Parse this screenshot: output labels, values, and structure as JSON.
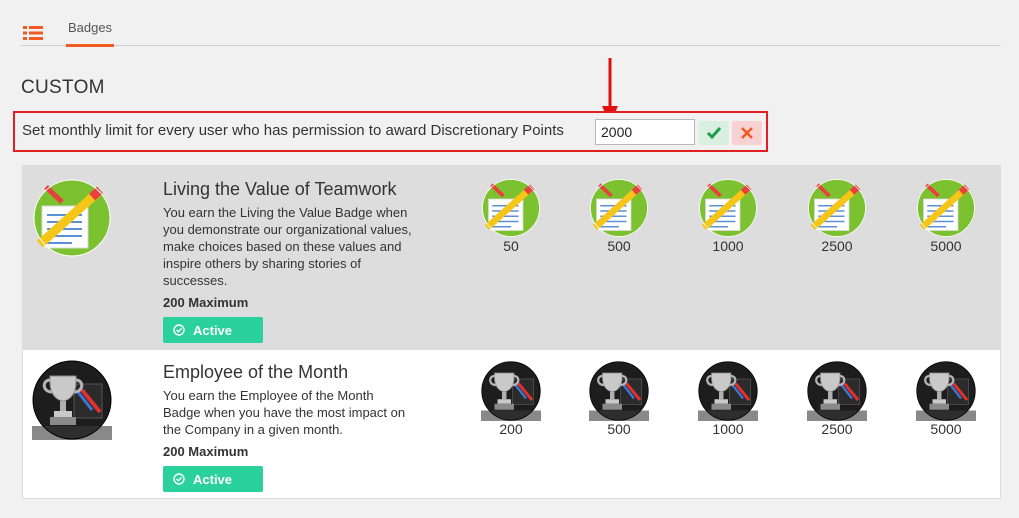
{
  "header": {
    "menu_icon": "list-icon",
    "tab_label": "Badges"
  },
  "section_title": "CUSTOM",
  "limit": {
    "label": "Set monthly limit for every user who has permission to award Discretionary Points",
    "value": "2000",
    "confirm_icon": "check-icon",
    "cancel_icon": "close-icon"
  },
  "colors": {
    "accent": "#f15a22",
    "highlight_border": "#e02020",
    "active_green": "#2ad19a",
    "row_selected": "#dddddd"
  },
  "badges": [
    {
      "name": "Living the Value of Teamwork",
      "description": "You earn the Living the Value Badge when you demonstrate our organizational values, make choices based on these values and inspire others by sharing stories of successes.",
      "maximum": "200 Maximum",
      "status": "Active",
      "icon": "pencil-document-badge-icon",
      "levels": [
        "50",
        "500",
        "1000",
        "2500",
        "5000"
      ]
    },
    {
      "name": "Employee of the Month",
      "description": "You earn the Employee of the Month Badge when you have the most impact on the Company in a given month.",
      "maximum": "200 Maximum",
      "status": "Active",
      "icon": "trophy-badge-icon",
      "levels": [
        "200",
        "500",
        "1000",
        "2500",
        "5000"
      ]
    }
  ]
}
